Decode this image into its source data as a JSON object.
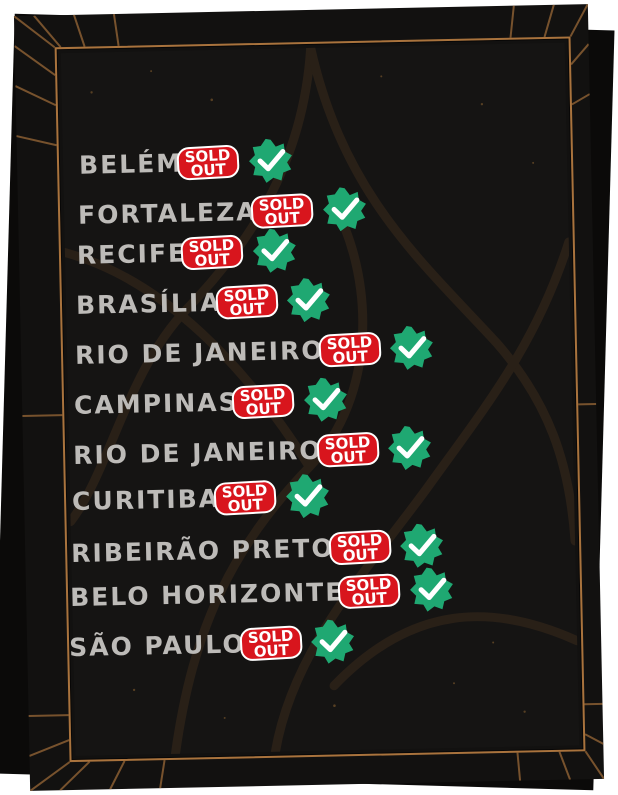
{
  "badge": {
    "line1": "SOLD",
    "line2": "OUT"
  },
  "colors": {
    "background": "#121110",
    "frame": "#a9733d",
    "text": "#bdbbb8",
    "badge_red": "#d8151d",
    "check_green": "#1fa872"
  },
  "cities": [
    {
      "name": "BELÉM"
    },
    {
      "name": "FORTALEZA"
    },
    {
      "name": "RECIFE"
    },
    {
      "name": "BRASÍLIA"
    },
    {
      "name": "RIO DE JANEIRO"
    },
    {
      "name": "CAMPINAS"
    },
    {
      "name": "RIO DE JANEIRO"
    },
    {
      "name": "CURITIBA"
    },
    {
      "name": "RIBEIRÃO PRETO"
    },
    {
      "name": "BELO HORIZONTE"
    },
    {
      "name": "SÃO PAULO"
    }
  ],
  "icons": {
    "check": "verified-check-icon",
    "badge": "sold-out-badge"
  }
}
